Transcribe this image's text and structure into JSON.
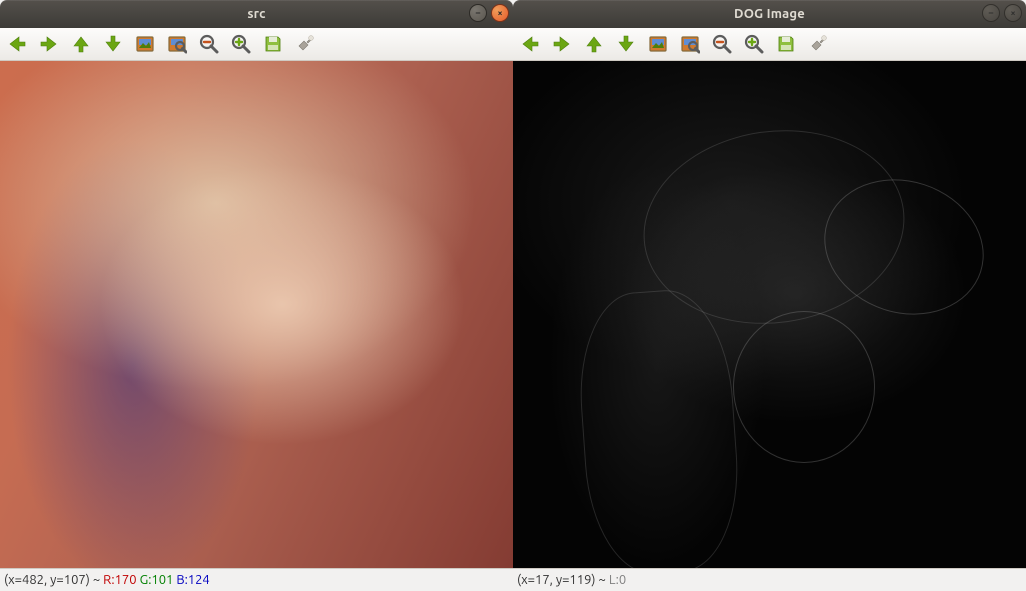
{
  "windows": [
    {
      "title": "src",
      "focused": true,
      "toolbar_icons": [
        "nav-prev-icon",
        "nav-next-icon",
        "nav-up-icon",
        "nav-down-icon",
        "image-color-icon",
        "image-zoomfit-icon",
        "zoom-out-icon",
        "zoom-in-icon",
        "save-icon",
        "flashlight-icon"
      ],
      "status": {
        "coord_text": "(x=482, y=107) ~ ",
        "r_label": "R:170",
        "g_label": "G:101",
        "b_label": "B:124"
      }
    },
    {
      "title": "DOG Image",
      "focused": false,
      "toolbar_icons": [
        "nav-prev-icon",
        "nav-next-icon",
        "nav-up-icon",
        "nav-down-icon",
        "image-color-icon",
        "image-zoomfit-icon",
        "zoom-out-icon",
        "zoom-in-icon",
        "save-icon",
        "flashlight-icon"
      ],
      "status": {
        "coord_text": "(x=17, y=119) ~ ",
        "l_label": "L:0"
      }
    }
  ],
  "title_button_glyphs": {
    "min": "–",
    "close": "×"
  }
}
